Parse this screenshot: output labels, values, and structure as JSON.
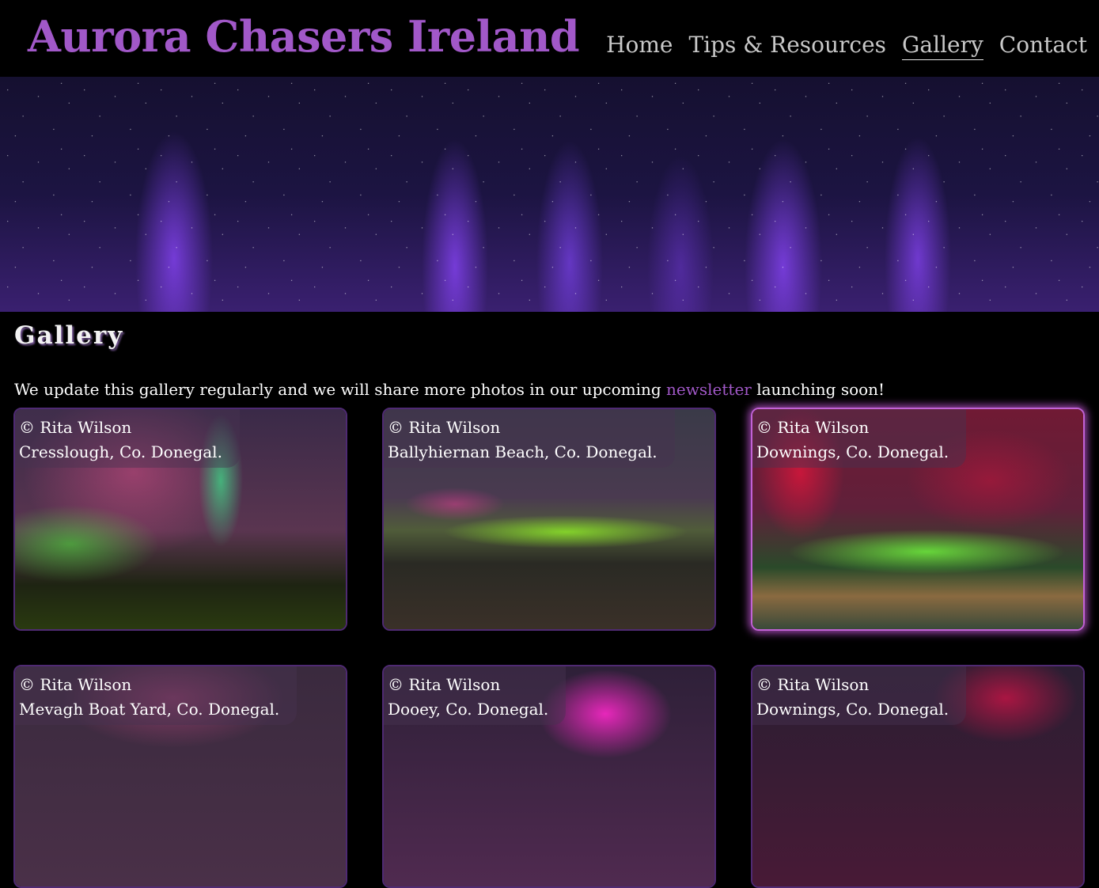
{
  "site": {
    "title": "Aurora Chasers Ireland",
    "accent_color": "#a158c8"
  },
  "nav": {
    "items": [
      {
        "label": "Home",
        "active": false
      },
      {
        "label": "Tips & Resources",
        "active": false
      },
      {
        "label": "Gallery",
        "active": true
      },
      {
        "label": "Contact",
        "active": false
      }
    ]
  },
  "page": {
    "title": "Gallery",
    "intro_before": "We update this gallery regularly and we will share more photos in our upcoming ",
    "intro_link": "newsletter",
    "intro_after": " launching soon!"
  },
  "gallery": [
    {
      "credit": "© Rita Wilson",
      "location": "Cresslough, Co. Donegal."
    },
    {
      "credit": "© Rita Wilson",
      "location": "Ballyhiernan Beach, Co. Donegal."
    },
    {
      "credit": "© Rita Wilson",
      "location": "Downings, Co. Donegal."
    },
    {
      "credit": "© Rita Wilson",
      "location": "Mevagh Boat Yard, Co. Donegal."
    },
    {
      "credit": "© Rita Wilson",
      "location": "Dooey, Co. Donegal."
    },
    {
      "credit": "© Rita Wilson",
      "location": "Downings, Co. Donegal."
    }
  ]
}
